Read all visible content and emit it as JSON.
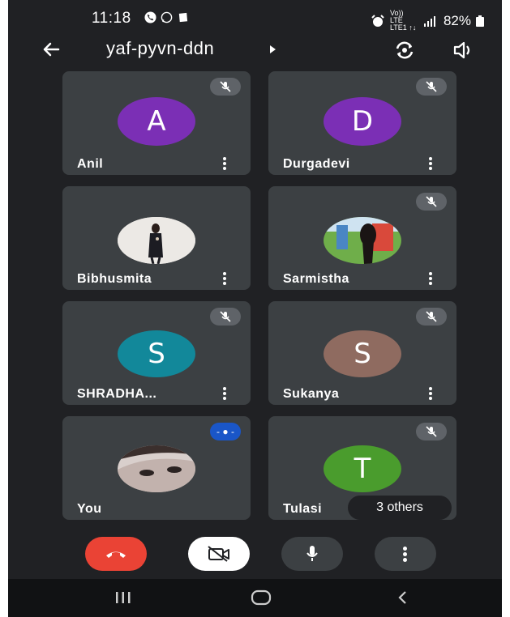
{
  "status_bar": {
    "time": "11:18",
    "signal_text": "Vo)) LTE LTE1 ↑↓",
    "battery": "82%"
  },
  "header": {
    "meeting_code": "yaf-pyvn-ddn"
  },
  "participants": [
    {
      "name": "Anil",
      "initial": "A",
      "avatar_color": "#7b2fb5",
      "muted": true
    },
    {
      "name": "Durgadevi",
      "initial": "D",
      "avatar_color": "#7b2fb5",
      "muted": true
    },
    {
      "name": "Bibhusmita",
      "initial": "",
      "avatar_color": "",
      "muted": false,
      "photo": "photo"
    },
    {
      "name": "Sarmistha",
      "initial": "",
      "avatar_color": "",
      "muted": true,
      "photo": "photo"
    },
    {
      "name": "SHRADHA...",
      "initial": "S",
      "avatar_color": "#12889a",
      "muted": true
    },
    {
      "name": "Sukanya",
      "initial": "S",
      "avatar_color": "#8f6b60",
      "muted": true
    },
    {
      "name": "You",
      "initial": "",
      "avatar_color": "",
      "muted": false,
      "speaking": true,
      "photo": "photo"
    },
    {
      "name": "Tulasi",
      "initial": "T",
      "avatar_color": "#4a9c2d",
      "muted": true
    }
  ],
  "others_label": "3 others",
  "controls": {
    "end_call_color": "#ea4335",
    "camera_off_color": "#ffffff",
    "button_color": "#3c4043"
  }
}
